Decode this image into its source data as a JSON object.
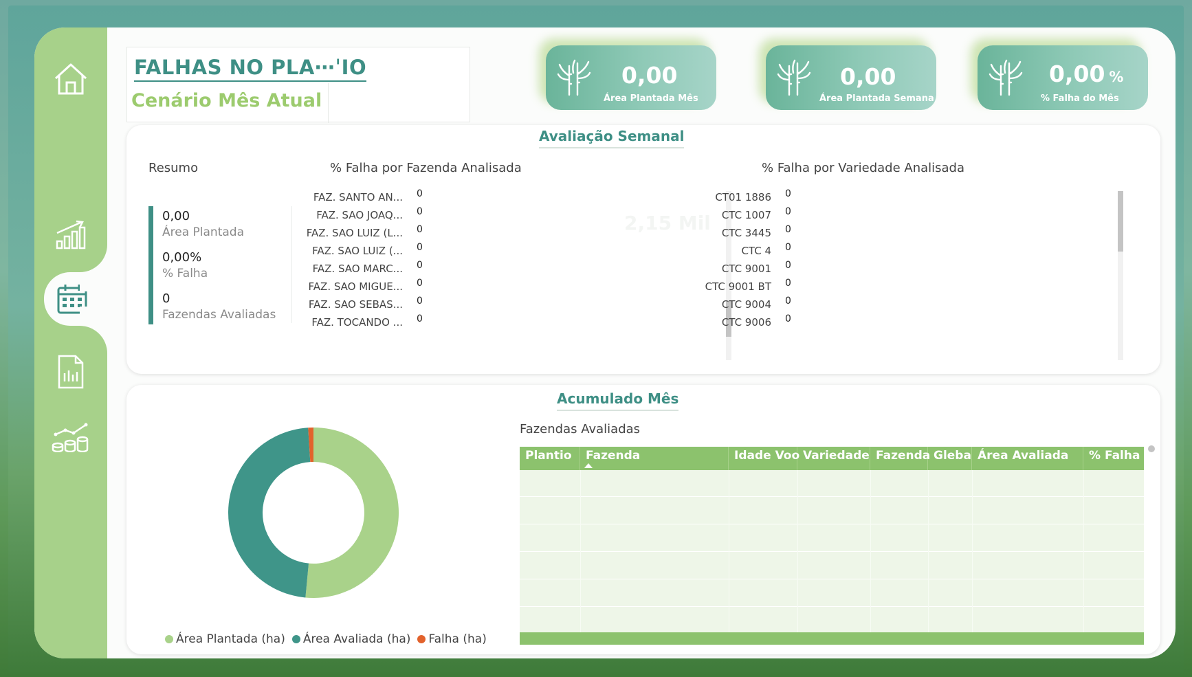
{
  "header": {
    "title": "FALHAS NO PLA⋯ˈIO",
    "subtitle": "Cenário Mês Atual"
  },
  "kpis": [
    {
      "value": "0,00",
      "suffix": "",
      "label": "Área Plantada Mês"
    },
    {
      "value": "0,00",
      "suffix": "",
      "label": "Área Plantada Semana"
    },
    {
      "value": "0,00",
      "suffix": "%",
      "label": "% Falha do Mês"
    }
  ],
  "weekly": {
    "title": "Avaliação Semanal",
    "resumo": {
      "label": "Resumo",
      "items": [
        {
          "value": "0,00",
          "label": "Área Plantada"
        },
        {
          "value": "0,00%",
          "label": "% Falha"
        },
        {
          "value": "0",
          "label": "Fazendas Avaliadas"
        }
      ]
    },
    "farm_chart": {
      "label": "% Falha por Fazenda Analisada",
      "watermark": "2,15 Mil",
      "rows": [
        {
          "name": "FAZ. SANTO AN...",
          "value": "0"
        },
        {
          "name": "FAZ. SAO JOAQ...",
          "value": "0"
        },
        {
          "name": "FAZ. SAO LUIZ (L...",
          "value": "0"
        },
        {
          "name": "FAZ. SAO LUIZ (...",
          "value": "0"
        },
        {
          "name": "FAZ. SAO MARC...",
          "value": "0"
        },
        {
          "name": "FAZ. SAO MIGUE...",
          "value": "0"
        },
        {
          "name": "FAZ. SAO SEBAS...",
          "value": "0"
        },
        {
          "name": "FAZ. TOCANDO ...",
          "value": "0"
        }
      ]
    },
    "variety_chart": {
      "label": "% Falha por Variedade Analisada",
      "rows": [
        {
          "name": "CT01 1886",
          "value": "0"
        },
        {
          "name": "CTC 1007",
          "value": "0"
        },
        {
          "name": "CTC 3445",
          "value": "0"
        },
        {
          "name": "CTC 4",
          "value": "0"
        },
        {
          "name": "CTC 9001",
          "value": "0"
        },
        {
          "name": "CTC 9001 BT",
          "value": "0"
        },
        {
          "name": "CTC 9004",
          "value": "0"
        },
        {
          "name": "CTC 9006",
          "value": "0"
        }
      ]
    }
  },
  "monthly": {
    "title": "Acumulado Mês",
    "table_label": "Fazendas Avaliadas",
    "columns": [
      "Plantio",
      "Fazenda",
      "Idade Voo",
      "Variedade",
      "Fazenda",
      "Gleba",
      "Área Avaliada",
      "% Falha"
    ],
    "legend": [
      "Área Plantada (ha)",
      "Área Avaliada (ha)",
      "Falha (ha)"
    ]
  },
  "colors": {
    "primary": "#3e8f85",
    "light_green": "#a7d18a",
    "donut_plantada": "#a9d28a",
    "donut_avaliada": "#3f9589",
    "donut_falha": "#e2622c"
  },
  "chart_data": {
    "type": "pie",
    "categories": [
      "Área Plantada (ha)",
      "Área Avaliada (ha)",
      "Falha (ha)"
    ],
    "values": [
      51.5,
      47.5,
      1.0
    ],
    "legend": "bottom"
  },
  "icons": {
    "nav": [
      "home-icon",
      "growth-chart-icon",
      "calendar-icon",
      "report-icon",
      "coins-growth-icon"
    ],
    "kpi": "sugarcane-icon"
  }
}
